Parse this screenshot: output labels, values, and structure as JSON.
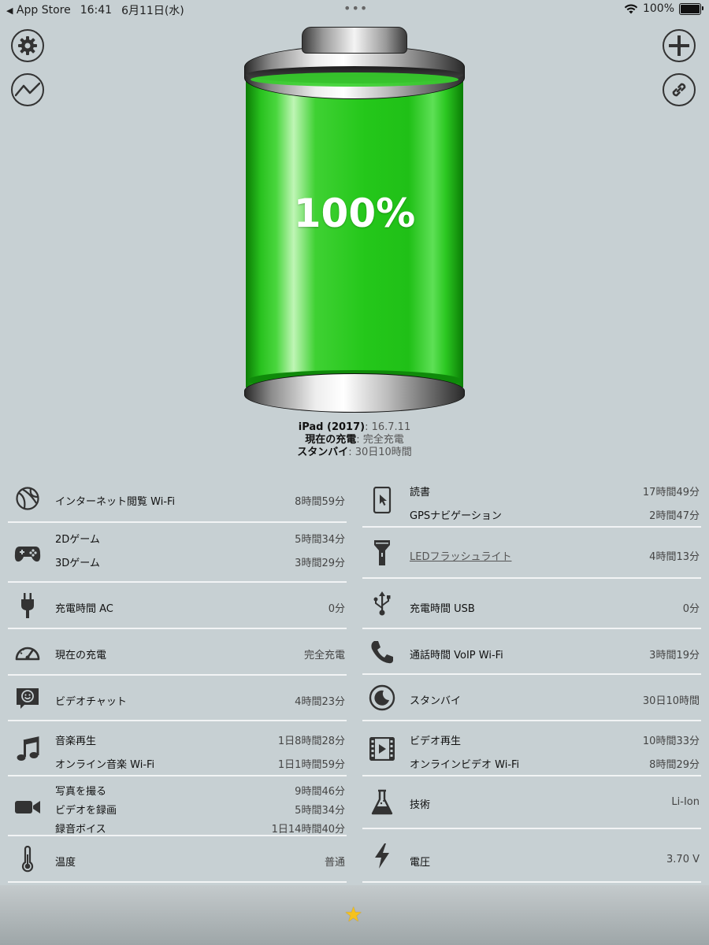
{
  "status_bar": {
    "back_label": "App Store",
    "time": "16:41",
    "date": "6月11日(水)",
    "battery": "100%"
  },
  "battery": {
    "percent": "100%",
    "level": 1.0,
    "color": "#23c51a"
  },
  "device": {
    "model_key": "iPad (2017)",
    "model_val": ": 16.7.11",
    "charge_key": "現在の充電",
    "charge_val": ": 完全充電",
    "standby_key": "スタンバイ",
    "standby_val": ": 30日10時間"
  },
  "left_rows": [
    {
      "icon": "globe-icon",
      "lines": [
        {
          "label": "インターネット閲覧 Wi-Fi",
          "value": "8時間59分"
        }
      ]
    },
    {
      "icon": "gamepad-icon",
      "lines": [
        {
          "label": "2Dゲーム",
          "value": "5時間34分"
        },
        {
          "label": "3Dゲーム",
          "value": "3時間29分"
        }
      ]
    },
    {
      "icon": "plug-icon",
      "lines": [
        {
          "label": "充電時間 AC",
          "value": "0分"
        }
      ]
    },
    {
      "icon": "gauge-icon",
      "lines": [
        {
          "label": "現在の充電",
          "value": "完全充電"
        }
      ]
    },
    {
      "icon": "video-chat-icon",
      "lines": [
        {
          "label": "ビデオチャット",
          "value": "4時間23分"
        }
      ]
    },
    {
      "icon": "music-note-icon",
      "lines": [
        {
          "label": "音楽再生",
          "value": "1日8時間28分"
        },
        {
          "label": "オンライン音楽 Wi-Fi",
          "value": "1日1時間59分"
        }
      ]
    },
    {
      "icon": "video-camera-icon",
      "lines": [
        {
          "label": "写真を撮る",
          "value": "9時間46分"
        },
        {
          "label": "ビデオを録画",
          "value": "5時間34分"
        },
        {
          "label": "録音ボイス",
          "value": "1日14時間40分"
        }
      ]
    },
    {
      "icon": "thermometer-icon",
      "lines": [
        {
          "label": "温度",
          "value": "普通"
        }
      ]
    }
  ],
  "right_rows": [
    {
      "icon": "tablet-touch-icon",
      "lines": [
        {
          "label": "読書",
          "value": "17時間49分"
        },
        {
          "label": "GPSナビゲーション",
          "value": "2時間47分"
        }
      ]
    },
    {
      "icon": "flashlight-icon",
      "lines": [
        {
          "label": "LEDフラッシュライト",
          "value": "4時間13分"
        }
      ]
    },
    {
      "icon": "usb-icon",
      "lines": [
        {
          "label": "充電時間 USB",
          "value": "0分"
        }
      ]
    },
    {
      "icon": "phone-icon",
      "lines": [
        {
          "label": "通話時間 VoIP Wi-Fi",
          "value": "3時間19分"
        }
      ]
    },
    {
      "icon": "moon-icon",
      "lines": [
        {
          "label": "スタンバイ",
          "value": "30日10時間"
        }
      ]
    },
    {
      "icon": "film-icon",
      "lines": [
        {
          "label": "ビデオ再生",
          "value": "10時間33分"
        },
        {
          "label": "オンラインビデオ Wi-Fi",
          "value": "8時間29分"
        }
      ]
    },
    {
      "icon": "flask-icon",
      "lines": [
        {
          "label": "技術",
          "value": "Li-Ion"
        }
      ]
    },
    {
      "icon": "lightning-icon",
      "lines": [
        {
          "label": "電圧",
          "value": "3.70 V"
        }
      ]
    }
  ]
}
